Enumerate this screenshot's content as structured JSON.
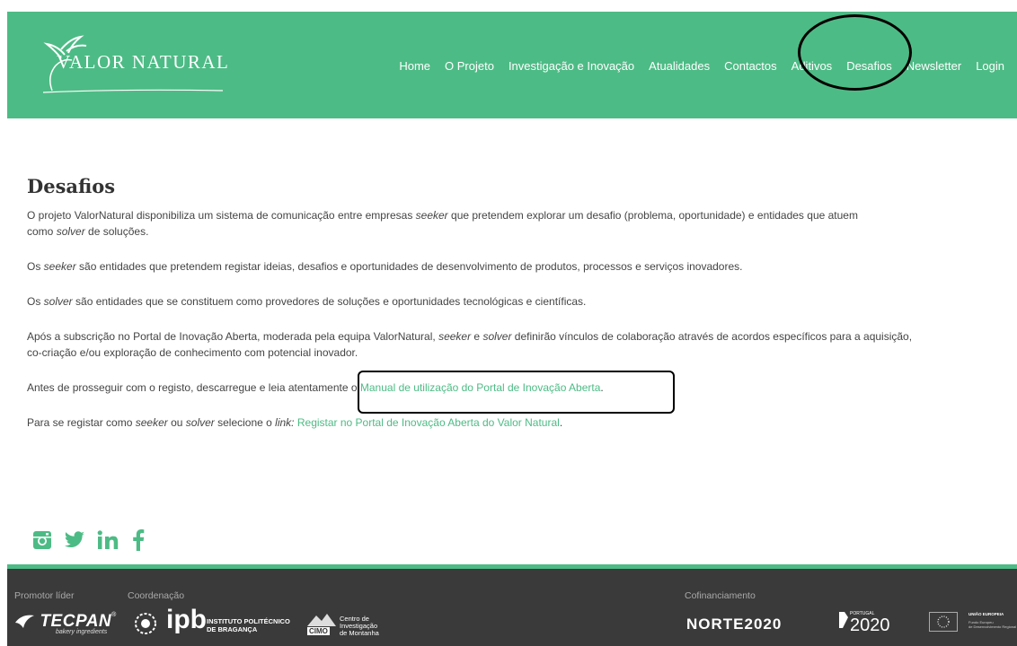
{
  "header": {
    "logo_text": "VALOR NATURAL",
    "nav": [
      "Home",
      "O Projeto",
      "Investigação e Inovação",
      "Atualidades",
      "Contactos",
      "Aditivos",
      "Desafios",
      "Newsletter",
      "Login"
    ]
  },
  "main": {
    "title": "Desafios",
    "p1_a": "O projeto ValorNatural disponibiliza um sistema de comunicação entre empresas ",
    "p1_seeker": "seeker",
    "p1_b": " que pretendem explorar um desafio (problema, oportunidade) e entidades que atuem",
    "p1_c": "como ",
    "p1_solver": "solver",
    "p1_d": " de soluções.",
    "p2_seeker": "Os seeker",
    "p2_rest": "  são entidades que pretendem registar ideias, desafios e oportunidades de desenvolvimento de produtos, processos e serviços inovadores.",
    "p3_a": "Os ",
    "p3_solver": "solver",
    "p3_rest": " são entidades que se constituem como provedores de soluções e oportunidades tecnológicas e científicas.",
    "p4_a": "Após a subscrição no Portal de Inovação Aberta, moderada pela equipa ValorNatural, ",
    "p4_seeker": "seeker",
    "p4_b": " e ",
    "p4_solver": "solver",
    "p4_c": " definirão vínculos de colaboração através de acordos específicos para a aquisição,",
    "p4_d": "co-criação e/ou exploração de conhecimento com potencial inovador.",
    "p5_a": "Antes de prosseguir com o registo, descarregue e leia atentamente o ",
    "p5_link": "Manual de utilização do Portal de Inovação Aberta",
    "p5_b": ".",
    "p6_a": "Para se registar como ",
    "p6_seeker": "seeker",
    "p6_b": " ou ",
    "p6_solver": "solver",
    "p6_c": " selecione o ",
    "p6_linkword": "link:",
    "p6_link": " Registar no Portal de Inovação Aberta do Valor Natural",
    "p6_d": "."
  },
  "social": [
    "instagram-icon",
    "twitter-icon",
    "linkedin-icon",
    "facebook-icon"
  ],
  "footer": {
    "promotor_label": "Promotor líder",
    "coordenacao_label": "Coordenação",
    "cofinanciamento_label": "Cofinanciamento",
    "tecpan": "TECPAN",
    "tecpan_sub": "bakery ingredients",
    "ipb": "ipb",
    "ipb_text1": "INSTITUTO POLITÉCNICO",
    "ipb_text2": "DE BRAGANÇA",
    "cimo_box": "CIMO",
    "cimo_text1": "Centro de",
    "cimo_text2": "Investigação",
    "cimo_text3": "de Montanha",
    "norte": "NORTE2020",
    "portugal_small": "PORTUGAL",
    "portugal": "2020",
    "ue": "UNIÃO EUROPEIA",
    "ue_sub1": "Fundo Europeu",
    "ue_sub2": "de Desenvolvimento Regional"
  },
  "colors": {
    "brand": "#4dbb85",
    "footer_bg": "#3a3a3a"
  }
}
